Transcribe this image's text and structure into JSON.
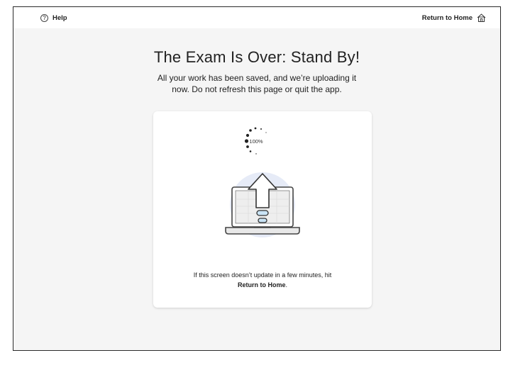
{
  "header": {
    "help_label": "Help",
    "help_icon": "help-circle-icon",
    "home_label": "Return to Home",
    "home_icon": "home-icon"
  },
  "main": {
    "title": "The Exam Is Over: Stand By!",
    "subtitle_line1": "All your work has been saved, and we’re uploading it",
    "subtitle_line2": "now. Do not refresh this page or quit the app."
  },
  "card": {
    "progress_label": "100%",
    "progress_fraction": 1.0,
    "illustration_icon": "laptop-upload-icon",
    "note_line1": "If this screen doesn’t update in a few minutes, hit",
    "note_link": "Return to Home",
    "note_end": "."
  },
  "colors": {
    "background": "#f5f5f5",
    "card": "#ffffff",
    "accent_blue": "#c9e3f5",
    "illustration_circle": "#e6ebf7"
  }
}
